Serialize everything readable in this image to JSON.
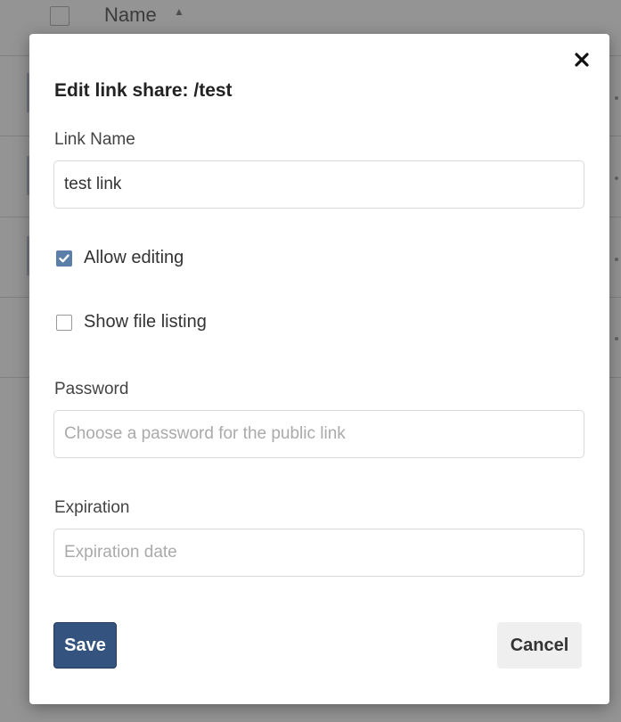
{
  "background": {
    "column_header": "Name"
  },
  "modal": {
    "title": "Edit link share: /test",
    "link_name": {
      "label": "Link Name",
      "value": "test link"
    },
    "allow_editing": {
      "label": "Allow editing",
      "checked": true
    },
    "show_file_listing": {
      "label": "Show file listing",
      "checked": false
    },
    "password": {
      "label": "Password",
      "placeholder": "Choose a password for the public link",
      "value": ""
    },
    "expiration": {
      "label": "Expiration",
      "placeholder": "Expiration date",
      "value": ""
    },
    "save_label": "Save",
    "cancel_label": "Cancel"
  },
  "colors": {
    "primary_button": "#34547f",
    "checkbox_checked": "#5b7fa8",
    "cancel_button": "#efefef"
  },
  "icons": {
    "close": "close-icon",
    "sort": "sort-ascending-icon",
    "checkmark": "checkmark-icon"
  }
}
